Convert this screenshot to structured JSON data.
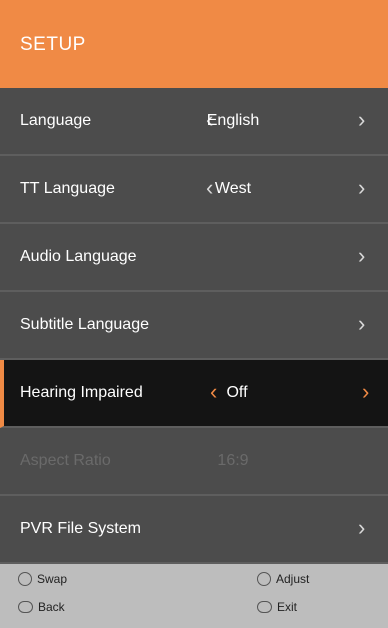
{
  "header": {
    "title": "SETUP"
  },
  "menu": {
    "items": [
      {
        "label": "Language",
        "value": "English",
        "left_arrow": "‹",
        "right_arrow": "›"
      },
      {
        "label": "TT Language",
        "value": "West",
        "left_arrow": "‹",
        "right_arrow": "›"
      },
      {
        "label": "Audio Language",
        "value": "",
        "left_arrow": "",
        "right_arrow": "›"
      },
      {
        "label": "Subtitle Language",
        "value": "",
        "left_arrow": "",
        "right_arrow": "›"
      },
      {
        "label": "Hearing Impaired",
        "value": "Off",
        "left_arrow": "‹",
        "right_arrow": "›"
      },
      {
        "label": "Aspect Ratio",
        "value": "16:9",
        "left_arrow": "",
        "right_arrow": ""
      },
      {
        "label": "PVR File System",
        "value": "",
        "left_arrow": "",
        "right_arrow": "›"
      }
    ],
    "selected_index": 4,
    "disabled_index": 5
  },
  "footer": {
    "swap": "Swap",
    "back": "Back",
    "adjust": "Adjust",
    "exit": "Exit",
    "icons": {
      "swap": "dpad-updown-icon",
      "back": "menu-button-icon",
      "adjust": "dpad-leftright-icon",
      "exit": "exit-button-icon"
    }
  },
  "colors": {
    "accent": "#f08a45",
    "selected_bg": "#141414",
    "row_bg": "#4c4c4c",
    "footer_bg": "#bdbdbd"
  }
}
